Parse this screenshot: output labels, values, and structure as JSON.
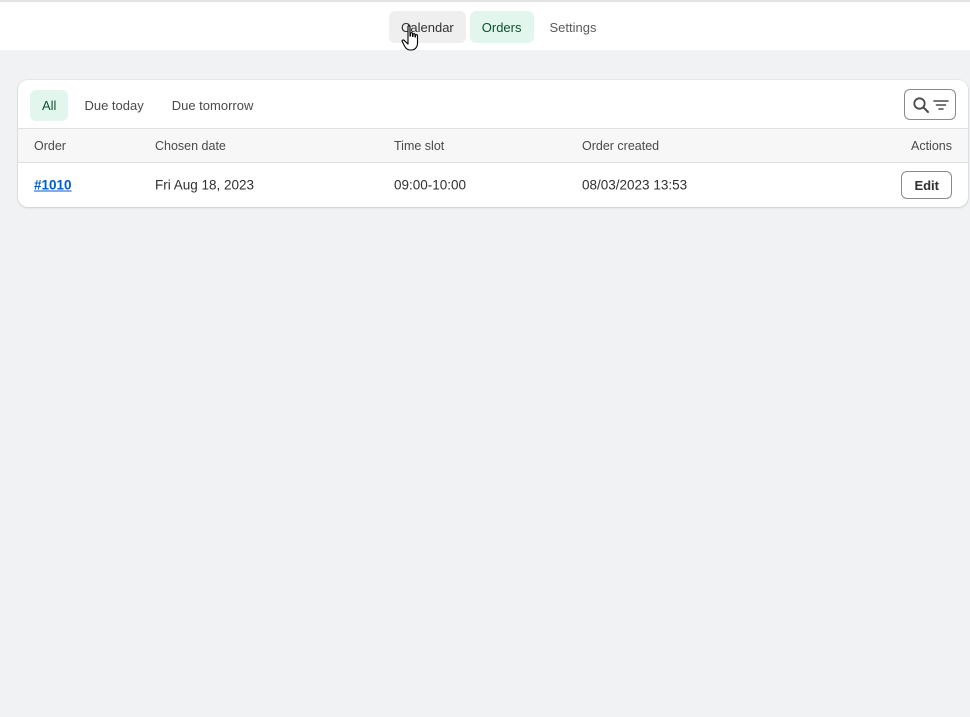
{
  "topnav": {
    "tabs": [
      {
        "label": "Calendar"
      },
      {
        "label": "Orders"
      },
      {
        "label": "Settings"
      }
    ]
  },
  "orders": {
    "filters": [
      {
        "label": "All"
      },
      {
        "label": "Due today"
      },
      {
        "label": "Due tomorrow"
      }
    ],
    "columns": {
      "order": "Order",
      "chosen_date": "Chosen date",
      "time_slot": "Time slot",
      "order_created": "Order created",
      "actions": "Actions"
    },
    "rows": [
      {
        "order": "#1010",
        "chosen_date": "Fri Aug 18, 2023",
        "time_slot": "09:00-10:00",
        "order_created": "08/03/2023 13:53",
        "action": "Edit"
      }
    ]
  },
  "icons": {
    "search": "search-icon",
    "filter": "filter-icon",
    "cursor": "hand-pointer-icon"
  }
}
